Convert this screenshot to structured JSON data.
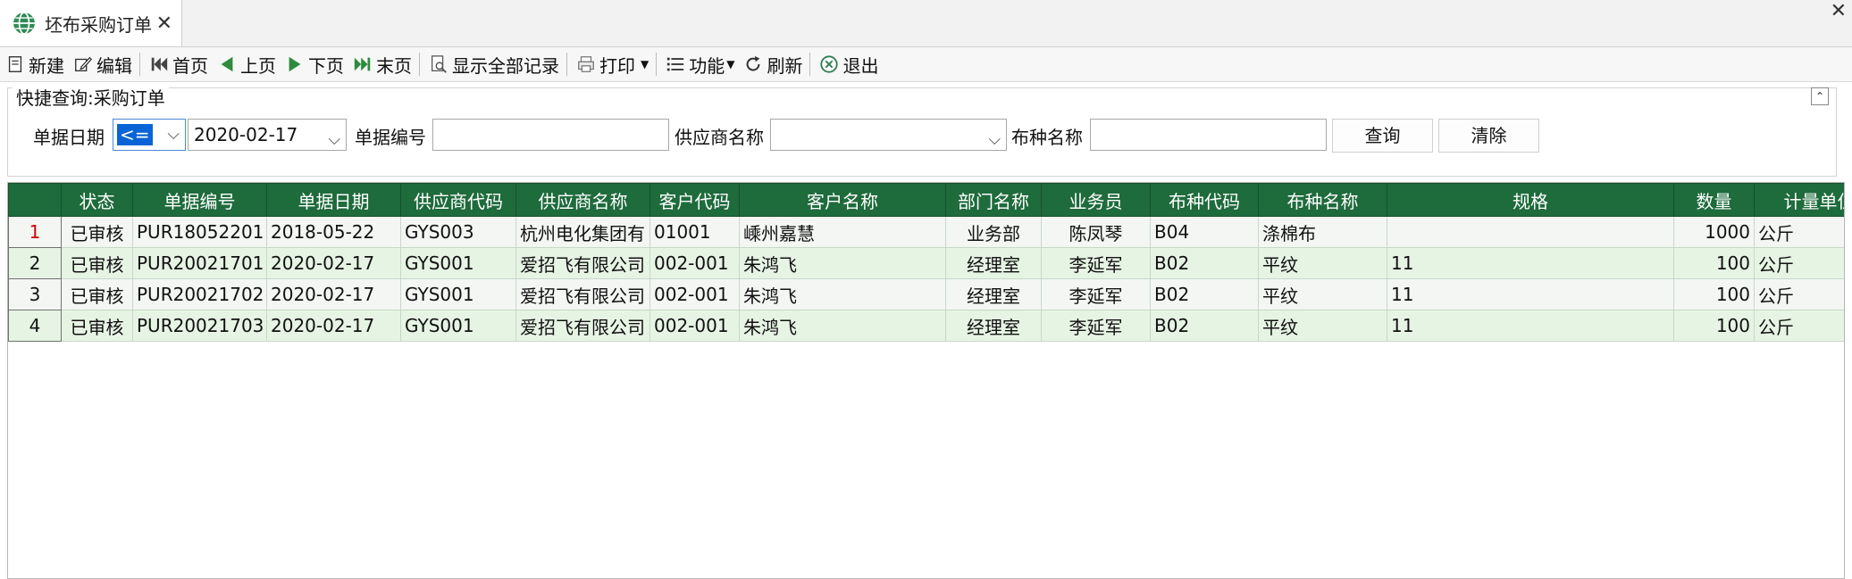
{
  "tab": {
    "title": "坯布采购订单",
    "close": "✕"
  },
  "window": {
    "close": "✕"
  },
  "toolbar": {
    "new": "新建",
    "edit": "编辑",
    "first": "首页",
    "prev": "上页",
    "next": "下页",
    "last": "末页",
    "show_all": "显示全部记录",
    "print": "打印",
    "functions": "功能",
    "refresh": "刷新",
    "exit": "退出"
  },
  "query": {
    "legend": "快捷查询:采购订单",
    "date_label": "单据日期",
    "date_operator": "<=",
    "date_value": "2020-02-17",
    "doc_no_label": "单据编号",
    "doc_no_value": "",
    "supplier_label": "供应商名称",
    "supplier_value": "",
    "fabric_label": "布种名称",
    "fabric_value": "",
    "search_button": "查询",
    "clear_button": "清除"
  },
  "grid": {
    "columns": [
      "",
      "状态",
      "单据编号",
      "单据日期",
      "供应商代码",
      "供应商名称",
      "客户代码",
      "客户名称",
      "部门名称",
      "业务员",
      "布种代码",
      "布种名称",
      "规格",
      "数量",
      "计量单位"
    ],
    "rows": [
      [
        "1",
        "已审核",
        "PUR18052201",
        "2018-05-22",
        "GYS003",
        "杭州电化集团有",
        "01001",
        "嵊州嘉慧",
        "业务部",
        "陈凤琴",
        "B04",
        "涤棉布",
        "",
        "1000",
        "公斤"
      ],
      [
        "2",
        "已审核",
        "PUR20021701",
        "2020-02-17",
        "GYS001",
        "爱招飞有限公司",
        "002-001",
        "朱鸿飞",
        "经理室",
        "李延军",
        "B02",
        "平纹",
        "11",
        "100",
        "公斤"
      ],
      [
        "3",
        "已审核",
        "PUR20021702",
        "2020-02-17",
        "GYS001",
        "爱招飞有限公司",
        "002-001",
        "朱鸿飞",
        "经理室",
        "李延军",
        "B02",
        "平纹",
        "11",
        "100",
        "公斤"
      ],
      [
        "4",
        "已审核",
        "PUR20021703",
        "2020-02-17",
        "GYS001",
        "爱招飞有限公司",
        "002-001",
        "朱鸿飞",
        "经理室",
        "李延军",
        "B02",
        "平纹",
        "11",
        "100",
        "公斤"
      ]
    ]
  },
  "colors": {
    "header_bg": "#1e6b3c",
    "row_alt": "#e6f4e4",
    "accent": "#0a64d6"
  }
}
